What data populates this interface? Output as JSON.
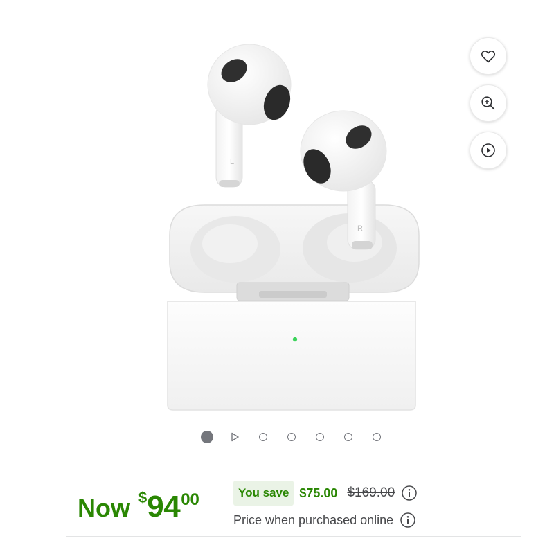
{
  "actions": {
    "favorite_icon": "heart-icon",
    "zoom_icon": "zoom-in-icon",
    "video_icon": "play-circle-icon"
  },
  "product": {
    "image_icon": "airpods-product-image",
    "earbud_left_mark": "L",
    "earbud_right_mark": "R"
  },
  "carousel": {
    "total_slides": 7,
    "active_index": 1,
    "video_slide_index": 2
  },
  "price": {
    "now_label": "Now",
    "currency": "$",
    "dollars": "94",
    "cents": "00",
    "you_save_label": "You save",
    "save_amount": "$75.00",
    "was_price": "$169.00",
    "online_note": "Price when purchased online"
  },
  "colors": {
    "price_green": "#2a8703",
    "save_badge_bg": "#eaf3e6",
    "text_gray": "#46474a",
    "indicator_gray": "#74767c"
  }
}
